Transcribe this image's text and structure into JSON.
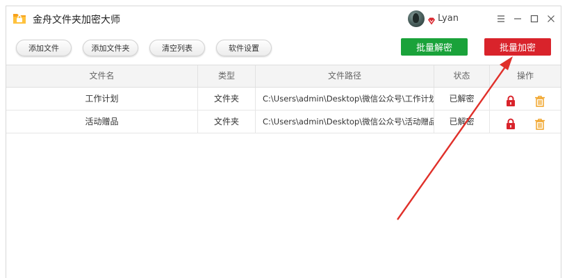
{
  "app": {
    "title": "金舟文件夹加密大师",
    "icon": "folder-app-icon"
  },
  "user": {
    "name": "Lyan",
    "badge_icon": "vip-diamond-icon"
  },
  "window_controls": [
    "menu-icon",
    "minimize-icon",
    "maximize-icon",
    "close-icon"
  ],
  "toolbar": {
    "add_file": "添加文件",
    "add_folder": "添加文件夹",
    "clear_list": "清空列表",
    "settings": "软件设置",
    "batch_decrypt": "批量解密",
    "batch_encrypt": "批量加密"
  },
  "colors": {
    "decrypt_green": "#1aa23a",
    "encrypt_red": "#d9232b",
    "lock_red": "#d9232b",
    "trash_orange": "#f0a020",
    "arrow_red": "#e0302a"
  },
  "table": {
    "headers": {
      "name": "文件名",
      "type": "类型",
      "path": "文件路径",
      "status": "状态",
      "ops": "操作"
    },
    "rows": [
      {
        "name": "工作计划",
        "type": "文件夹",
        "path": "C:\\Users\\admin\\Desktop\\微信公众号\\工作计划",
        "status": "已解密",
        "ops": [
          "lock-icon",
          "trash-icon"
        ]
      },
      {
        "name": "活动赠品",
        "type": "文件夹",
        "path": "C:\\Users\\admin\\Desktop\\微信公众号\\活动赠品",
        "status": "已解密",
        "ops": [
          "lock-icon",
          "trash-icon"
        ]
      }
    ]
  }
}
